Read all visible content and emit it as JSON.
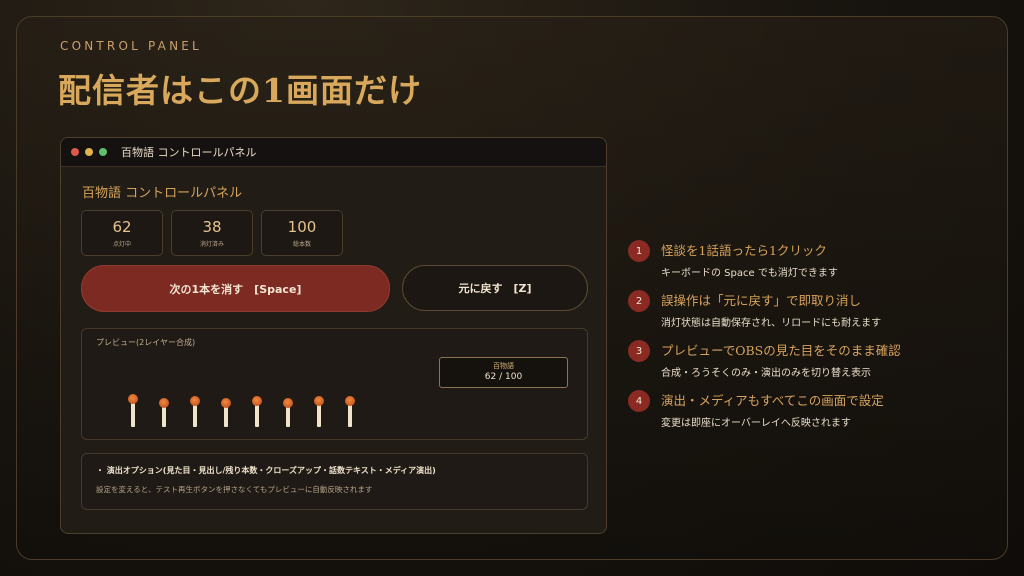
{
  "kicker": "CONTROL PANEL",
  "headline": "配信者はこの1画面だけ",
  "window": {
    "title": "百物語 コントロールパネル",
    "panel_title": "百物語 コントロールパネル",
    "stats": [
      {
        "value": "62",
        "label": "点灯中"
      },
      {
        "value": "38",
        "label": "消灯済み"
      },
      {
        "value": "100",
        "label": "総本数"
      }
    ],
    "primary_button": "次の1本を消す　[Space]",
    "secondary_button": "元に戻す　[Z]",
    "preview": {
      "label": "プレビュー(2レイヤー合成)",
      "badge_title": "百物語",
      "badge_count": "62 / 100"
    },
    "options": {
      "title": "・ 演出オプション(見た目・見出し/残り本数・クローズアップ・話数テキスト・メディア演出)",
      "desc": "設定を変えると、テスト再生ボタンを押さなくてもプレビューに自動反映されます"
    }
  },
  "features": [
    {
      "num": "1",
      "title": "怪談を1話語ったら1クリック",
      "desc": "キーボードの Space でも消灯できます"
    },
    {
      "num": "2",
      "title": "誤操作は「元に戻す」で即取り消し",
      "desc": "消灯状態は自動保存され、リロードにも耐えます"
    },
    {
      "num": "3",
      "title": "プレビューでOBSの見た目をそのまま確認",
      "desc": "合成・ろうそくのみ・演出のみを切り替え表示"
    },
    {
      "num": "4",
      "title": "演出・メディアもすべてこの画面で設定",
      "desc": "変更は即座にオーバーレイへ反映されます"
    }
  ],
  "colors": {
    "accent_gold": "#d8a95c",
    "primary_red": "#7d2a22",
    "number_badge": "#8a2a22"
  }
}
